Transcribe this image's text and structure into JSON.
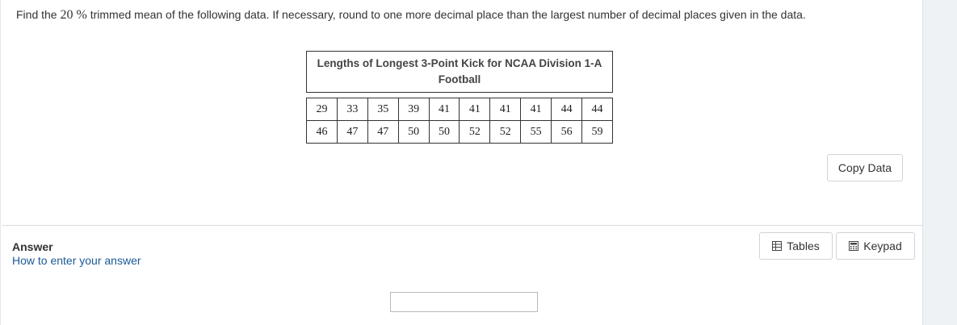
{
  "question": {
    "prefix": "Find the",
    "percent": "20 %",
    "suffix": "trimmed mean of the following data. If necessary, round to one more decimal place than the largest number of decimal places given in the data."
  },
  "table": {
    "title": "Lengths of Longest 3-Point Kick for NCAA Division 1-A Football",
    "rows": [
      [
        "29",
        "33",
        "35",
        "39",
        "41",
        "41",
        "41",
        "41",
        "44",
        "44"
      ],
      [
        "46",
        "47",
        "47",
        "50",
        "50",
        "52",
        "52",
        "55",
        "56",
        "59"
      ]
    ]
  },
  "buttons": {
    "copy_data": "Copy Data",
    "tables": "Tables",
    "keypad": "Keypad"
  },
  "answer": {
    "label": "Answer",
    "help_link": "How to enter your answer",
    "value": ""
  },
  "icons": {
    "tables": "table-icon",
    "keypad": "calculator-icon"
  }
}
